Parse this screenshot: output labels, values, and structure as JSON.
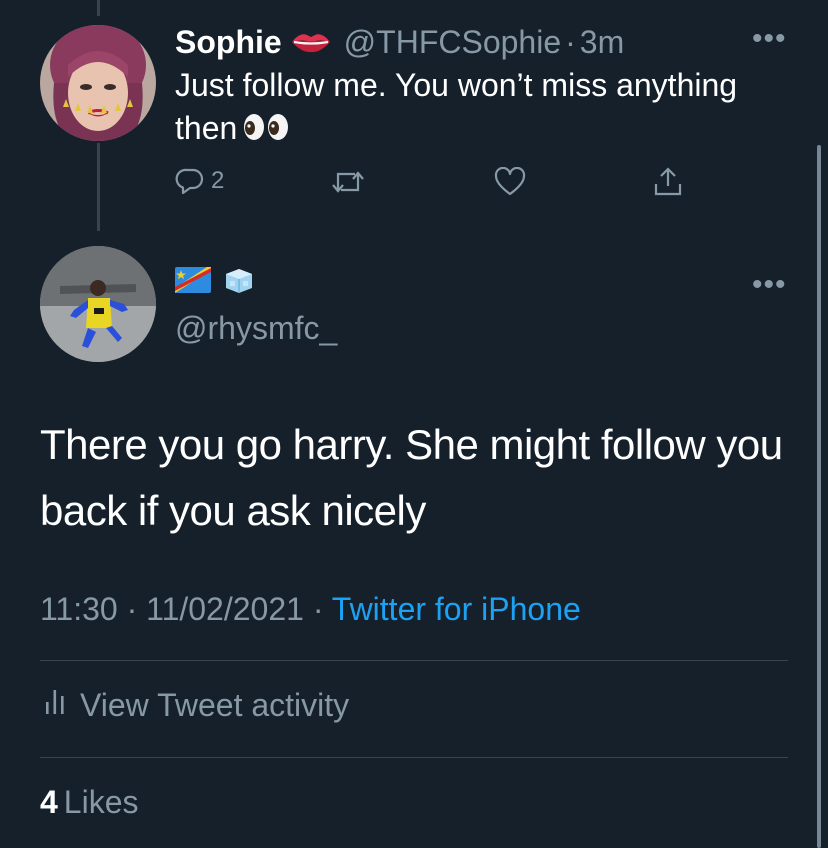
{
  "reply_to": {
    "display_name": "Sophie",
    "emoji_icon": "lips-icon",
    "handle": "@THFCSophie",
    "separator": "·",
    "time_ago": "3m",
    "text": "Just follow me. You won’t miss anything then",
    "trailing_emoji": "eyes-icon",
    "reply_count": "2",
    "actions": [
      "reply-icon",
      "retweet-icon",
      "like-icon",
      "share-icon"
    ]
  },
  "tweet": {
    "flag_icons": [
      "dr-congo-flag-icon",
      "ice-cube-icon"
    ],
    "handle": "@rhysmfc_",
    "text": "There you go harry. She might follow you back if you ask nicely",
    "time": "11:30",
    "separator": "·",
    "date": "11/02/2021",
    "separator2": "·",
    "source": "Twitter for iPhone",
    "activity_label": "View Tweet activity",
    "likes_count": "4",
    "likes_label": "Likes"
  },
  "colors": {
    "background": "#15202b",
    "text_primary": "#ffffff",
    "text_muted": "#8899a6",
    "link": "#1da1f2",
    "divider": "#38444d"
  }
}
